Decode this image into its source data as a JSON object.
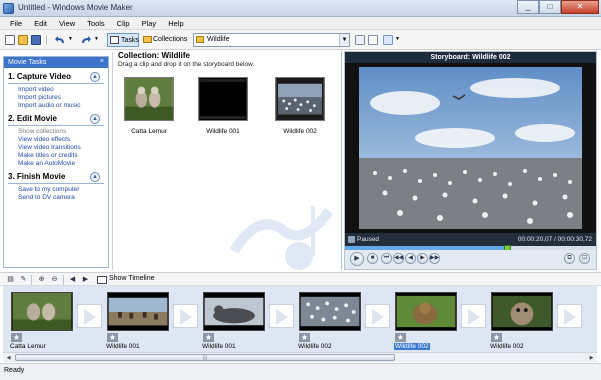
{
  "window": {
    "title": "Untitled - Windows Movie Maker",
    "controls": [
      "_",
      "□",
      "✕"
    ]
  },
  "menu": [
    "File",
    "Edit",
    "View",
    "Tools",
    "Clip",
    "Play",
    "Help"
  ],
  "toolbar": {
    "tasks_label": "Tasks",
    "collections_label": "Collections",
    "collection_select": "Wildlife"
  },
  "tasks_pane": {
    "header": "Movie Tasks",
    "close": "×",
    "sections": [
      {
        "title": "1. Capture Video",
        "links": [
          "Import video",
          "Import pictures",
          "Import audio or music"
        ]
      },
      {
        "title": "2. Edit Movie",
        "links": [
          "Show collections",
          "View video effects",
          "View video transitions",
          "Make titles or credits",
          "Make an AutoMovie"
        ]
      },
      {
        "title": "3. Finish Movie",
        "links": [
          "Save to my computer",
          "Send to DV camera"
        ]
      }
    ]
  },
  "collection": {
    "title": "Collection: Wildlife",
    "subtitle": "Drag a clip and drop it on the storyboard below.",
    "clips": [
      "Catta Lemur",
      "Wildlife 001",
      "Wildlife 002"
    ]
  },
  "preview": {
    "title": "Storyboard: Wildlife 002",
    "state": "Paused",
    "time": "00:00:20,07 / 00:00:30,72",
    "progress": 0.65,
    "controls": {
      "play": "▶",
      "stop": "■",
      "rewind": "⏮",
      "back": "◀◀",
      "prev": "◀",
      "next": "▶",
      "fwd": "▶▶",
      "split": "⧉",
      "snapshot": "⊡"
    }
  },
  "storyboard": {
    "toolbar": {
      "show_timeline": "Show Timeline"
    },
    "items": [
      {
        "label": "Catta Lemur",
        "selected": false
      },
      {
        "label": "Wildlife 001",
        "selected": false
      },
      {
        "label": "Wildlife 001",
        "selected": false
      },
      {
        "label": "Wildlife 002",
        "selected": false
      },
      {
        "label": "Wildlife 002",
        "selected": true
      },
      {
        "label": "Wildlife 002",
        "selected": false
      }
    ],
    "star": "★"
  },
  "scrollbar": {
    "left": "◀",
    "right": "▶",
    "grip": "|||"
  },
  "statusbar": {
    "text": "Ready"
  },
  "colors": {
    "accent": "#3b74c8",
    "link": "#1f4ba8",
    "storyboard_bg": "#dde6f2",
    "preview_bar": "#1e2b3c"
  }
}
